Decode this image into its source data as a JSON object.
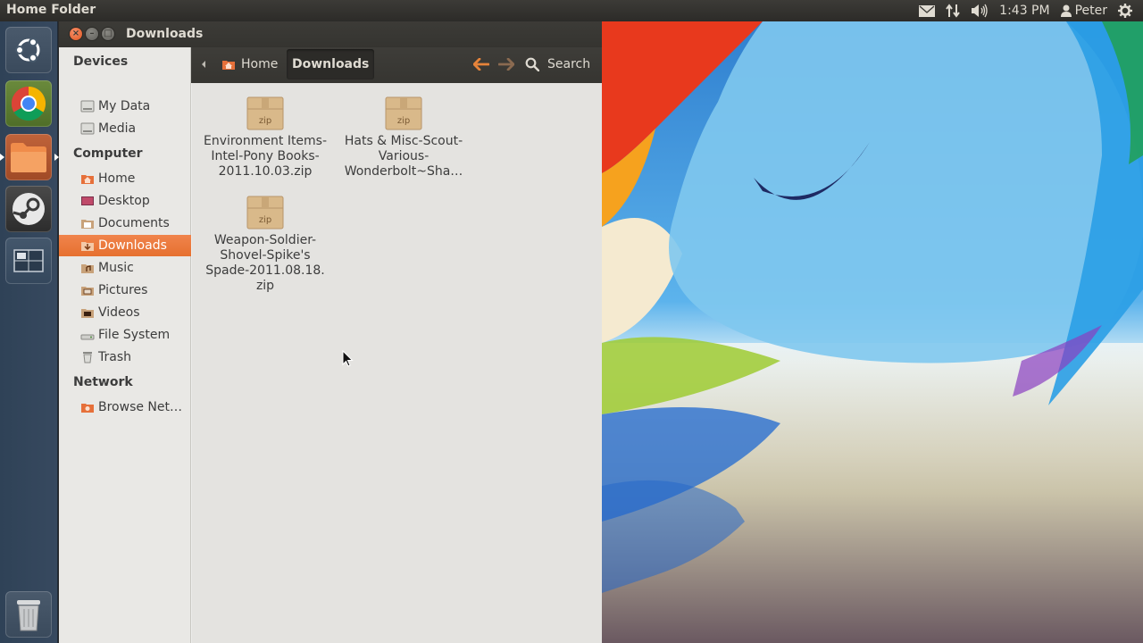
{
  "top_panel": {
    "app_title": "Home Folder",
    "time": "1:43 PM",
    "user": "Peter",
    "icons": [
      "mail-icon",
      "network-icon",
      "volume-icon",
      "user-icon",
      "gear-icon"
    ]
  },
  "launcher": {
    "items": [
      "dash",
      "chrome",
      "files",
      "steam",
      "workspace-switcher",
      "trash"
    ]
  },
  "window": {
    "title": "Downloads",
    "toolbar": {
      "crumbs": [
        "Home",
        "Downloads"
      ],
      "search_label": "Search"
    },
    "sidebar": {
      "sections": [
        {
          "heading": "Devices",
          "items": [
            "My Data",
            "Media"
          ]
        },
        {
          "heading": "Computer",
          "items": [
            "Home",
            "Desktop",
            "Documents",
            "Downloads",
            "Music",
            "Pictures",
            "Videos",
            "File System",
            "Trash"
          ]
        },
        {
          "heading": "Network",
          "items": [
            "Browse Net…"
          ]
        }
      ],
      "active": "Downloads"
    },
    "files": [
      {
        "name": "Environment Items-Intel-Pony Books-2011.10.03.zip",
        "lines": [
          "Environment Items-",
          "Intel-Pony Books-",
          "2011.10.03.zip"
        ],
        "badge": "zip"
      },
      {
        "name": "Hats & Misc-Scout-Various-Wonderbolt~Sha…",
        "lines": [
          "Hats & Misc-Scout-",
          "Various-",
          "Wonderbolt~Sha…"
        ],
        "badge": "zip"
      },
      {
        "name": "Weapon-Soldier-Shovel-Spike's Spade-2011.08.18.zip",
        "lines": [
          "Weapon-Soldier-",
          "Shovel-Spike's",
          "Spade-2011.08.18.",
          "zip"
        ],
        "badge": "zip"
      }
    ]
  },
  "colors": {
    "accent": "#e6702f",
    "panel": "#3c3b37",
    "launcher": "#33465b"
  }
}
